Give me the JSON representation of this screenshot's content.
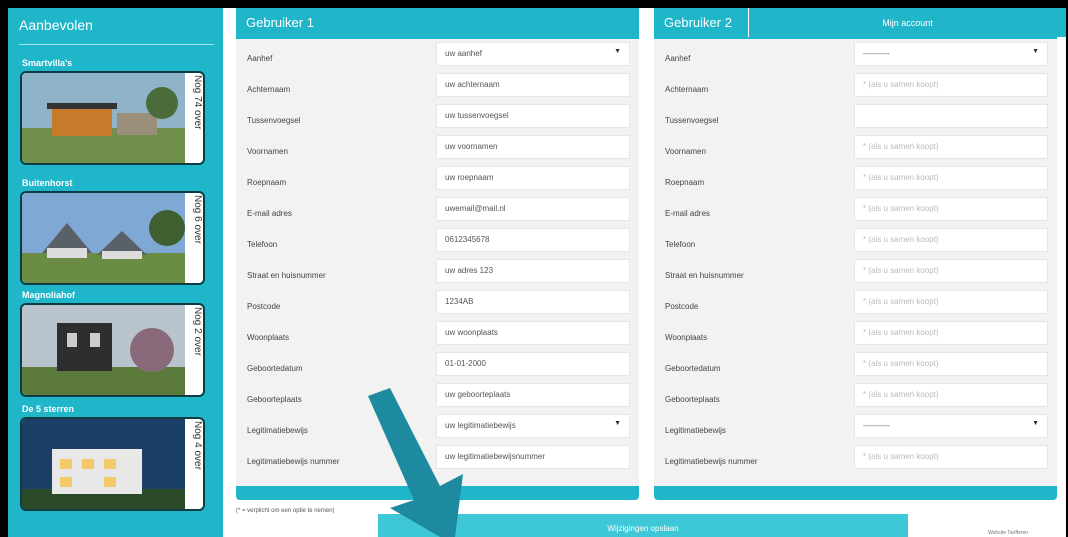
{
  "sidebar": {
    "title": "Aanbevolen",
    "projects": [
      {
        "name": "Smartvilla's",
        "count": "Nog 74 over"
      },
      {
        "name": "Buitenhorst",
        "count": "Nog 6 over"
      },
      {
        "name": "Magnoliahof",
        "count": "Nog 2 over"
      },
      {
        "name": "De 5 sterren",
        "count": "Nog 4 over"
      }
    ]
  },
  "account_tab": "Mijn account",
  "user1": {
    "title": "Gebruiker 1",
    "rows": [
      {
        "label": "Aanhef",
        "value": "uw aanhef",
        "type": "select"
      },
      {
        "label": "Achternaam",
        "value": "uw achternaam"
      },
      {
        "label": "Tussenvoegsel",
        "value": "uw tussenvoegsel"
      },
      {
        "label": "Voornamen",
        "value": "uw voornamen"
      },
      {
        "label": "Roepnaam",
        "value": "uw roepnaam"
      },
      {
        "label": "E-mail adres",
        "value": "uwemail@mail.nl"
      },
      {
        "label": "Telefoon",
        "value": "0612345678"
      },
      {
        "label": "Straat en huisnummer",
        "value": "uw adres 123"
      },
      {
        "label": "Postcode",
        "value": "1234AB"
      },
      {
        "label": "Woonplaats",
        "value": "uw woonplaats"
      },
      {
        "label": "Geboortedatum",
        "value": "01-01-2000"
      },
      {
        "label": "Geboorteplaats",
        "value": "uw geboorteplaats"
      },
      {
        "label": "Legitimatiebewijs",
        "value": "uw legitimatiebewijs",
        "type": "select"
      },
      {
        "label": "Legitimatiebewijs nummer",
        "value": "uw legitimatiebewijsnummer"
      }
    ]
  },
  "user2": {
    "title": "Gebruiker 2",
    "rows": [
      {
        "label": "Aanhef",
        "value": "----------",
        "type": "select"
      },
      {
        "label": "Achternaam",
        "placeholder": "* (als u samen koopt)"
      },
      {
        "label": "Tussenvoegsel",
        "placeholder": ""
      },
      {
        "label": "Voornamen",
        "placeholder": "* (als u samen koopt)"
      },
      {
        "label": "Roepnaam",
        "placeholder": "* (als u samen koopt)"
      },
      {
        "label": "E-mail adres",
        "placeholder": "* (als u samen koopt)"
      },
      {
        "label": "Telefoon",
        "placeholder": "* (als u samen koopt)"
      },
      {
        "label": "Straat en huisnummer",
        "placeholder": "* (als u samen koopt)"
      },
      {
        "label": "Postcode",
        "placeholder": "* (als u samen koopt)"
      },
      {
        "label": "Woonplaats",
        "placeholder": "* (als u samen koopt)"
      },
      {
        "label": "Geboortedatum",
        "placeholder": "* (als u samen koopt)"
      },
      {
        "label": "Geboorteplaats",
        "placeholder": "* (als u samen koopt)"
      },
      {
        "label": "Legitimatiebewijs",
        "value": "----------",
        "type": "select"
      },
      {
        "label": "Legitimatiebewijs nummer",
        "placeholder": "* (als u samen koopt)"
      }
    ]
  },
  "required_note": "(* = verplicht om een optie te nemen)",
  "save_button": "Wijzigingen opslaan",
  "small_link": "Website Tarifferen",
  "colors": {
    "accent": "#1fb6c9",
    "arrow": "#1e8aa0"
  }
}
